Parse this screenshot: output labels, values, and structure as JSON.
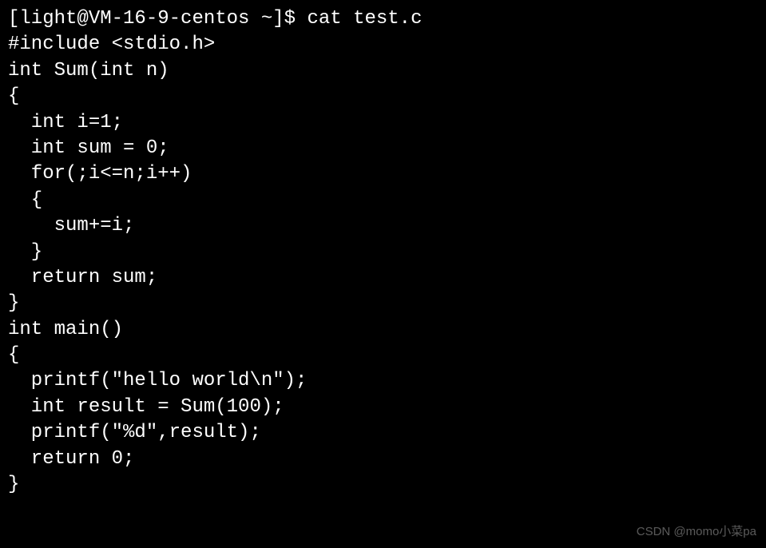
{
  "terminal": {
    "prompt_line": "[light@VM-16-9-centos ~]$ cat test.c",
    "code_lines": [
      "#include <stdio.h>",
      "",
      "int Sum(int n)",
      "{",
      "  int i=1;",
      "  int sum = 0;",
      "  for(;i<=n;i++)",
      "  {",
      "    sum+=i;",
      "  }",
      "  return sum;",
      "}",
      "int main()",
      "{",
      "  printf(\"hello world\\n\");",
      "  int result = Sum(100);",
      "  printf(\"%d\",result);",
      "  return 0;",
      "}"
    ]
  },
  "watermark": "CSDN @momo小菜pa"
}
